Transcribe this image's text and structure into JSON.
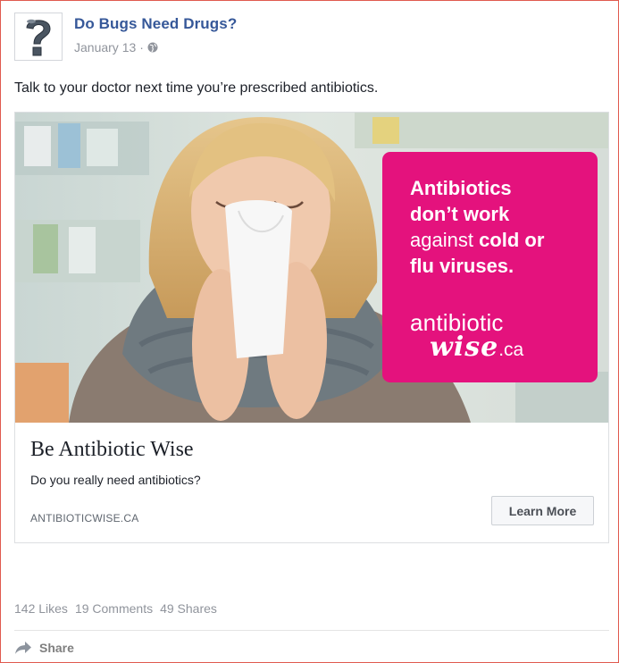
{
  "post": {
    "page_name": "Do Bugs Need Drugs?",
    "date": "January 13",
    "separator": "·",
    "privacy_icon": "globe-icon",
    "text": "Talk to your doctor next time you’re prescribed antibiotics."
  },
  "ad": {
    "image_alt_subject": "woman-sneezing-into-tissue",
    "overlay": {
      "line1": "Antibiotics",
      "line2": "don’t work",
      "line3_regular": "against ",
      "line3_bold": "cold or",
      "line4": "flu viruses.",
      "brand_top": "antibiotic",
      "brand_wise": "wise",
      "brand_ca": ".ca"
    },
    "title": "Be Antibiotic Wise",
    "description": "Do you really need antibiotics?",
    "domain": "ANTIBIOTICWISE.CA",
    "cta_label": "Learn More"
  },
  "stats": {
    "likes": "142 Likes",
    "comments": "19 Comments",
    "shares": "49 Shares"
  },
  "actions": {
    "share_label": "Share",
    "share_icon": "share-arrow-icon"
  },
  "colors": {
    "brand_pink": "#e4127d",
    "link_blue": "#365899",
    "border_red": "#e05a4f"
  }
}
